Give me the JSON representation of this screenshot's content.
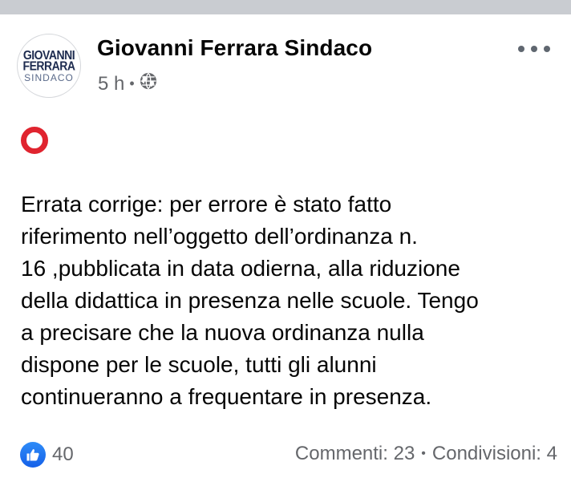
{
  "post": {
    "avatar": {
      "line1": "GIOVANNI",
      "line2": "FERRARA",
      "line3": "SINDACO"
    },
    "author": "Giovanni Ferrara Sindaco",
    "time": "5 h",
    "separator": "•",
    "privacy_icon": "globe-icon",
    "more_icon": "more-options-icon",
    "emoji": "red-circle-emoji",
    "text": "Errata corrige: per errore è stato fatto\nriferimento nell’oggetto dell’ordinanza n.\n16 ,pubblicata in data odierna, alla riduzione\ndella didattica in presenza nelle scuole. Tengo\na precisare che la nuova ordinanza nulla\ndispone per le scuole, tutti gli alunni\ncontinueranno a frequentare in presenza.",
    "reactions": {
      "icon": "like-icon",
      "count": "40"
    },
    "stats": {
      "comments": "Commenti: 23",
      "separator": "•",
      "shares": "Condivisioni: 4"
    }
  },
  "colors": {
    "top_strip": "#c9ccd1",
    "text_primary": "#050505",
    "text_secondary": "#65676b",
    "like_blue": "#1877f2",
    "emoji_red": "#e0242f"
  }
}
